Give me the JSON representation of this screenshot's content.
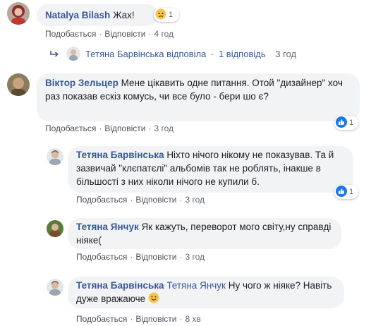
{
  "comments": [
    {
      "author": "Natalya Bilash",
      "text": "Жах!",
      "reaction_count": "1",
      "actions": {
        "like": "Подобається",
        "reply": "Відповісти",
        "time": "4 год"
      }
    },
    {
      "author": "Віктор Зельцер",
      "text": "Мене цікавить одне питання. Отой \"дизайнер\" хоч раз показав ескіз комусь, чи все було - бери шо є?",
      "reaction_count": "1",
      "actions": {
        "like": "Подобається",
        "reply": "Відповісти",
        "time": "3 год"
      }
    },
    {
      "author": "Тетяна Барвінська",
      "text": "Ніхто нічого нікому не показував. Та й зазвичай \"клєпатєлі\" альбомів так не роблять, інакше в більшості з них ніколи нічого не купили б.",
      "reaction_count": "1",
      "actions": {
        "like": "Подобається",
        "reply": "Відповісти",
        "time": "3 год"
      }
    },
    {
      "author": "Тетяна Янчук",
      "text": "Як кажуть, переворот мого світу,ну справді ніяке(",
      "actions": {
        "like": "Подобається",
        "reply": "Відповісти",
        "time": "3 год"
      }
    },
    {
      "author": "Тетяна Барвінська",
      "mention": "Тетяна Янчук",
      "text": "Ну чого ж ніяке? Навіть дуже вражаюче",
      "actions": {
        "like": "Подобається",
        "reply": "Відповісти",
        "time": "8 хв"
      }
    }
  ],
  "reply_summary": {
    "author": "Тетяна Барвінська",
    "text": "відповіла",
    "dot": "·",
    "count": "1 відповідь",
    "time": "3 год"
  },
  "colors": {
    "link": "#385898",
    "bubble": "#f2f3f5",
    "meta": "#606770",
    "like": "#1877f2"
  },
  "icons": {
    "reply_arrow": "reply-arrow-icon",
    "sad_reaction": "sad-reaction-icon",
    "like_reaction": "like-reaction-icon",
    "smile_emoji": "smile-emoji-icon"
  }
}
